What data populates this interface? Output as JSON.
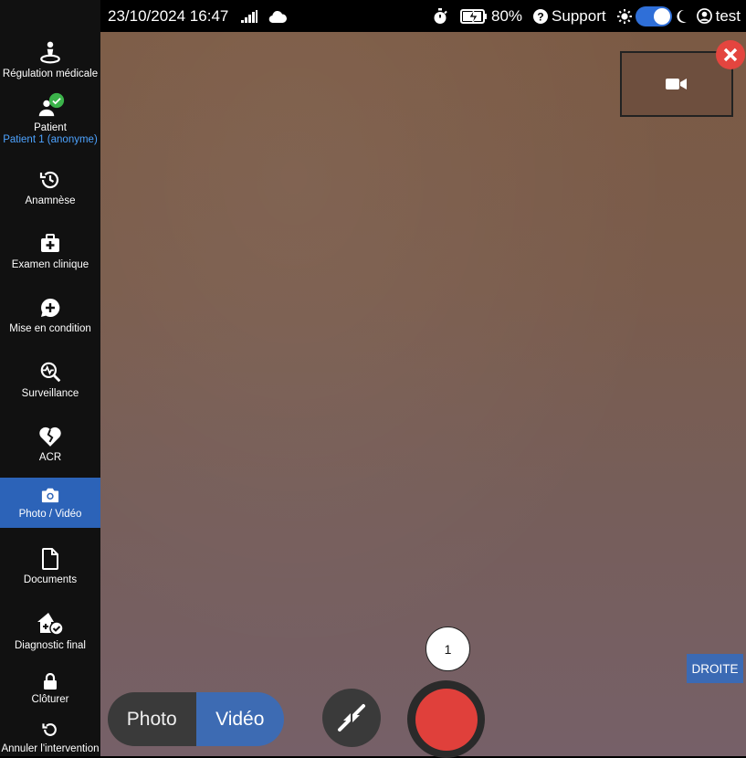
{
  "status_bar": {
    "datetime": "23/10/2024 16:47",
    "signal_icon": "signal-bars-icon",
    "cloud_icon": "cloud-icon",
    "timer_icon": "stopwatch-icon",
    "battery_icon": "battery-charging-icon",
    "battery_percent": "80%",
    "support_label": "Support",
    "theme_toggle": {
      "light_icon": "sun-icon",
      "dark_icon": "moon-icon"
    },
    "user_label": "test"
  },
  "sidebar": {
    "items": [
      {
        "label": "Régulation médicale",
        "icon": "person-location-icon"
      },
      {
        "label": "Patient",
        "sub": "Patient 1 (anonyme)",
        "icon": "patient-icon",
        "badge": "check-badge-icon"
      },
      {
        "label": "Anamnèse",
        "icon": "history-icon"
      },
      {
        "label": "Examen clinique",
        "icon": "medical-kit-icon"
      },
      {
        "label": "Mise en condition",
        "icon": "chat-plus-icon"
      },
      {
        "label": "Surveillance",
        "icon": "monitor-search-icon"
      },
      {
        "label": "ACR",
        "icon": "broken-heart-icon"
      },
      {
        "label": "Photo / Vidéo",
        "icon": "camera-icon",
        "active": true
      },
      {
        "label": "Documents",
        "icon": "document-icon"
      },
      {
        "label": "Diagnostic final",
        "icon": "house-check-icon"
      },
      {
        "label": "Clôturer",
        "icon": "lock-icon"
      },
      {
        "label": "Annuler l'intervention",
        "icon": "undo-icon"
      }
    ]
  },
  "camera": {
    "thumbnail_icon": "video-camera-icon",
    "close_icon": "close-icon",
    "side_button": "DROITE",
    "modes": {
      "photo": "Photo",
      "video": "Vidéo",
      "selected": "video"
    },
    "shrink_icon": "shrink-arrows-icon",
    "record_icon": "record-button",
    "counter": "1"
  },
  "colors": {
    "accent": "#2c63b8",
    "record": "#e0403b",
    "close": "#e4453f",
    "sidebar_bg": "#111111",
    "sub_label": "#4da3ff"
  }
}
